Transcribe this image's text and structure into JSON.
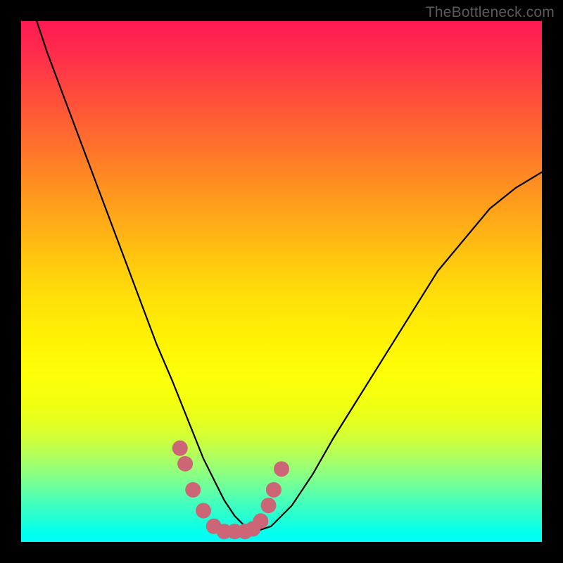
{
  "watermark": "TheBottleneck.com",
  "colors": {
    "frame": "#000000",
    "gradient_top": "#ff1a53",
    "gradient_bottom": "#00fdf8",
    "curve": "#000000",
    "scatter": "#cc6677"
  },
  "chart_data": {
    "type": "line",
    "title": "",
    "xlabel": "",
    "ylabel": "",
    "xlim": [
      0,
      100
    ],
    "ylim": [
      0,
      100
    ],
    "series": [
      {
        "name": "bottleneck-curve",
        "x": [
          3,
          5,
          8,
          11,
          14,
          17,
          20,
          23,
          26,
          29,
          31,
          33,
          35,
          37,
          39,
          41,
          43,
          45,
          48,
          52,
          56,
          60,
          65,
          70,
          75,
          80,
          85,
          90,
          95,
          100
        ],
        "y": [
          100,
          94,
          86,
          78,
          70,
          62,
          54,
          46,
          38,
          31,
          26,
          21,
          16,
          12,
          8,
          5,
          3,
          2,
          3,
          7,
          13,
          20,
          28,
          36,
          44,
          52,
          58,
          64,
          68,
          71
        ]
      }
    ],
    "scatter_points": {
      "name": "highlighted-pink-points",
      "x": [
        30.5,
        31.5,
        33.0,
        35.0,
        37.0,
        39.0,
        41.0,
        43.0,
        44.5,
        46.0,
        47.5,
        48.5,
        50.0
      ],
      "y": [
        18.0,
        15.0,
        10.0,
        6.0,
        3.0,
        2.0,
        2.0,
        2.0,
        2.5,
        4.0,
        7.0,
        10.0,
        14.0
      ]
    },
    "optimum_x": 41,
    "grid": false,
    "legend": false
  }
}
